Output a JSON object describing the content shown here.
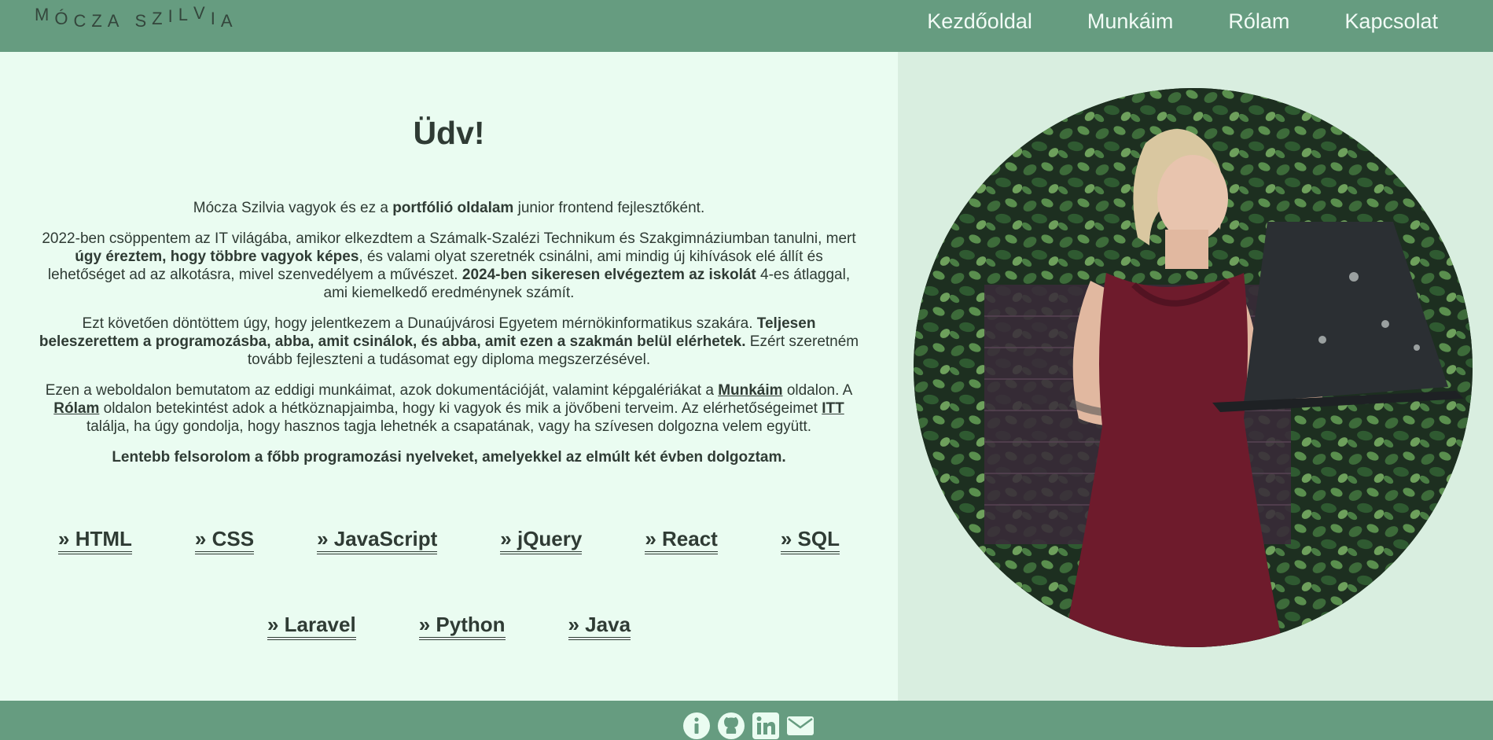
{
  "header": {
    "logo_letters": [
      "M",
      "Ó",
      "C",
      "Z",
      "A",
      " ",
      "S",
      "Z",
      "I",
      "L",
      "V",
      "I",
      "A"
    ],
    "nav": [
      "Kezdőoldal",
      "Munkáim",
      "Rólam",
      "Kapcsolat"
    ]
  },
  "main": {
    "title": "Üdv!",
    "p1": {
      "a": "Mócza Szilvia vagyok és ez a ",
      "b": "portfólió oldalam",
      "c": " junior frontend fejlesztőként."
    },
    "p2": {
      "a": "2022-ben csöppentem az IT világába, amikor elkezdtem a Számalk-Szalézi Technikum és Szakgimnáziumban tanulni, mert ",
      "b": "úgy éreztem, hogy többre vagyok képes",
      "c": ", és valami olyat szeretnék csinálni, ami mindig új kihívások elé állít és lehetőséget ad az alkotásra, mivel szenvedélyem a művészet. ",
      "d": "2024-ben sikeresen elvégeztem az iskolát",
      "e": " 4-es átlaggal, ami kiemelkedő eredménynek számít."
    },
    "p3": {
      "a": "Ezt követően döntöttem úgy, hogy jelentkezem a Dunaújvárosi Egyetem mérnökinformatikus szakára. ",
      "b": "Teljesen beleszerettem a programozásba, abba, amit csinálok, és abba, amit ezen a szakmán belül elérhetek.",
      "c": " Ezért szeretném tovább fejleszteni a tudásomat egy diploma megszerzésével."
    },
    "p4": {
      "a": "Ezen a weboldalon bemutatom az eddigi munkáimat, azok dokumentációját, valamint képgalériákat a ",
      "link1": "Munkáim",
      "b": " oldalon. A ",
      "link2": "Rólam",
      "c": " oldalon betekintést adok a hétköznapjaimba, hogy ki vagyok és mik a jövőbeni terveim. Az elérhetőségeimet ",
      "link3": "ITT",
      "d": " találja, ha úgy gondolja, hogy hasznos tagja lehetnék a csapatának, vagy ha szívesen dolgozna velem együtt."
    },
    "p5": "Lentebb felsorolom a főbb programozási nyelveket, amelyekkel az elmúlt két évben dolgoztam.",
    "languages_row1": [
      "» HTML",
      "» CSS",
      "» JavaScript",
      "» jQuery",
      "» React",
      "» SQL"
    ],
    "languages_row2": [
      "» Laravel",
      "» Python",
      "» Java"
    ]
  },
  "footer": {
    "icons": [
      "info-icon",
      "github-icon",
      "linkedin-icon",
      "mail-icon"
    ]
  },
  "colors": {
    "header_bg": "#669c80",
    "left_bg": "#eafcf1",
    "right_bg": "#d9eee0",
    "text": "#2f3b34",
    "dress": "#6e1b2c"
  }
}
